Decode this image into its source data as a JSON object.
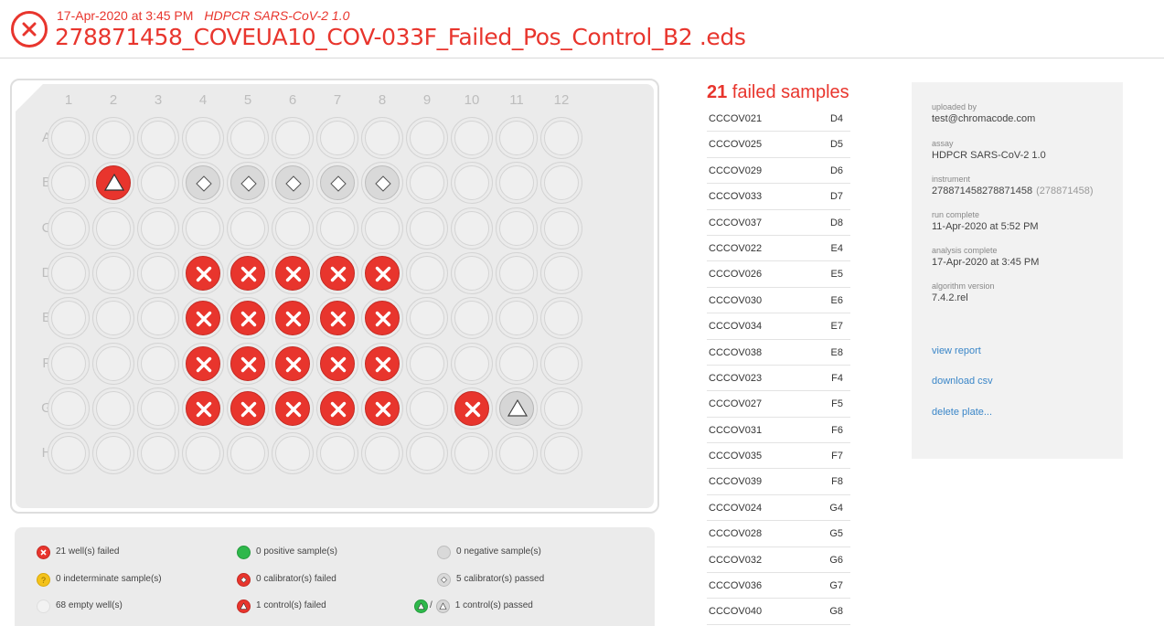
{
  "header": {
    "timestamp": "17-Apr-2020 at 3:45 PM",
    "assay": "HDPCR SARS-CoV-2 1.0",
    "file_name": "278871458_COVEUA10_COV-033F_Failed_Pos_Control_B2 .eds",
    "status_icon": "x-circle-icon",
    "accent_color": "#e8352d"
  },
  "plate": {
    "columns": [
      "1",
      "2",
      "3",
      "4",
      "5",
      "6",
      "7",
      "8",
      "9",
      "10",
      "11",
      "12"
    ],
    "rows": [
      "A",
      "B",
      "C",
      "D",
      "E",
      "F",
      "G",
      "H"
    ],
    "wells": {
      "B2": "control-failed",
      "B4": "calibrator-passed",
      "B5": "calibrator-passed",
      "B6": "calibrator-passed",
      "B7": "calibrator-passed",
      "B8": "calibrator-passed",
      "D4": "failed",
      "D5": "failed",
      "D6": "failed",
      "D7": "failed",
      "D8": "failed",
      "E4": "failed",
      "E5": "failed",
      "E6": "failed",
      "E7": "failed",
      "E8": "failed",
      "F4": "failed",
      "F5": "failed",
      "F6": "failed",
      "F7": "failed",
      "F8": "failed",
      "G4": "failed",
      "G5": "failed",
      "G6": "failed",
      "G7": "failed",
      "G8": "failed",
      "G10": "failed",
      "G11": "control-passed"
    }
  },
  "legend": [
    {
      "icon": "failed-icon",
      "label": "21 well(s) failed"
    },
    {
      "icon": "positive-icon",
      "label": "0 positive sample(s)"
    },
    {
      "icon": "negative-icon",
      "label": "0 negative sample(s)"
    },
    {
      "icon": "indeterminate-icon",
      "label": "0 indeterminate sample(s)"
    },
    {
      "icon": "calibrator-failed-icon",
      "label": "0 calibrator(s) failed"
    },
    {
      "icon": "calibrator-passed-icon",
      "label": "5 calibrator(s) passed"
    },
    {
      "icon": "empty-well-icon",
      "label": "68 empty well(s)"
    },
    {
      "icon": "control-failed-icon",
      "label": "1 control(s) failed"
    },
    {
      "icon": "control-passed-icon",
      "label": "1 control(s) passed"
    }
  ],
  "failed_samples": {
    "count": "21",
    "label": " failed samples",
    "items": [
      {
        "id": "CCCOV021",
        "well": "D4"
      },
      {
        "id": "CCCOV025",
        "well": "D5"
      },
      {
        "id": "CCCOV029",
        "well": "D6"
      },
      {
        "id": "CCCOV033",
        "well": "D7"
      },
      {
        "id": "CCCOV037",
        "well": "D8"
      },
      {
        "id": "CCCOV022",
        "well": "E4"
      },
      {
        "id": "CCCOV026",
        "well": "E5"
      },
      {
        "id": "CCCOV030",
        "well": "E6"
      },
      {
        "id": "CCCOV034",
        "well": "E7"
      },
      {
        "id": "CCCOV038",
        "well": "E8"
      },
      {
        "id": "CCCOV023",
        "well": "F4"
      },
      {
        "id": "CCCOV027",
        "well": "F5"
      },
      {
        "id": "CCCOV031",
        "well": "F6"
      },
      {
        "id": "CCCOV035",
        "well": "F7"
      },
      {
        "id": "CCCOV039",
        "well": "F8"
      },
      {
        "id": "CCCOV024",
        "well": "G4"
      },
      {
        "id": "CCCOV028",
        "well": "G5"
      },
      {
        "id": "CCCOV032",
        "well": "G6"
      },
      {
        "id": "CCCOV036",
        "well": "G7"
      },
      {
        "id": "CCCOV040",
        "well": "G8"
      }
    ]
  },
  "info": {
    "uploaded_by_label": "uploaded by",
    "uploaded_by": "test@chromacode.com",
    "assay_label": "assay",
    "assay": "HDPCR SARS-CoV-2 1.0",
    "instrument_label": "instrument",
    "instrument": "278871458278871458",
    "instrument_sub": "(278871458)",
    "run_complete_label": "run complete",
    "run_complete": "11-Apr-2020 at 5:52 PM",
    "analysis_complete_label": "analysis complete",
    "analysis_complete": "17-Apr-2020 at 3:45 PM",
    "algorithm_label": "algorithm version",
    "algorithm": "7.4.2.rel",
    "links": {
      "view_report": "view report",
      "download_csv": "download csv",
      "delete_plate": "delete plate..."
    }
  }
}
